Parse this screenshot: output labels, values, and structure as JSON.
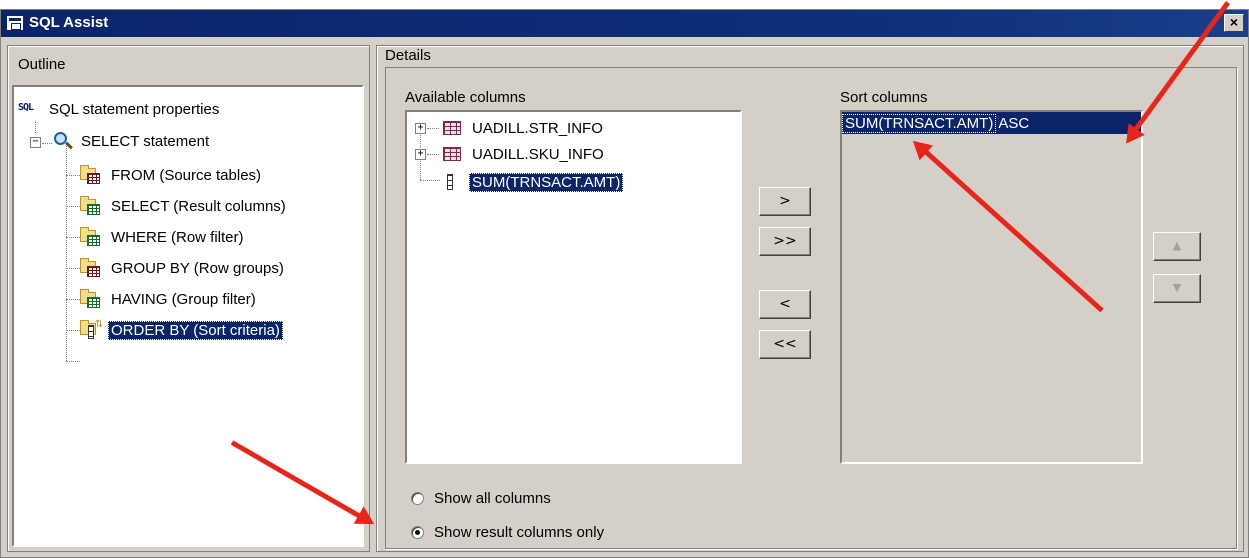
{
  "window": {
    "title": "SQL Assist",
    "close_label": "×"
  },
  "outline": {
    "label": "Outline",
    "items": [
      {
        "label": "SQL statement properties"
      },
      {
        "label": "SELECT statement"
      },
      {
        "label": "FROM (Source tables)"
      },
      {
        "label": "SELECT (Result columns)"
      },
      {
        "label": "WHERE (Row filter)"
      },
      {
        "label": "GROUP BY (Row groups)"
      },
      {
        "label": "HAVING (Group filter)"
      },
      {
        "label": "ORDER BY (Sort criteria)"
      }
    ]
  },
  "details": {
    "label": "Details",
    "available": {
      "label": "Available columns",
      "items": [
        {
          "label": "UADILL.STR_INFO"
        },
        {
          "label": "UADILL.SKU_INFO"
        },
        {
          "label": "SUM(TRNSACT.AMT)"
        }
      ]
    },
    "buttons": {
      "add": ">",
      "add_all": ">>",
      "remove": "<",
      "remove_all": "<<",
      "move_up": "▲",
      "move_down": "▼"
    },
    "sort": {
      "label": "Sort columns",
      "rows": [
        {
          "column": "SUM(TRNSACT.AMT)",
          "order": "ASC"
        }
      ]
    },
    "radios": {
      "show_all": "Show all columns",
      "show_result": "Show result columns only",
      "selected": "show_result"
    }
  },
  "colors": {
    "selection": "#0a246a",
    "annotation_arrow": "#e8251a",
    "window_face": "#d4d0c8"
  }
}
